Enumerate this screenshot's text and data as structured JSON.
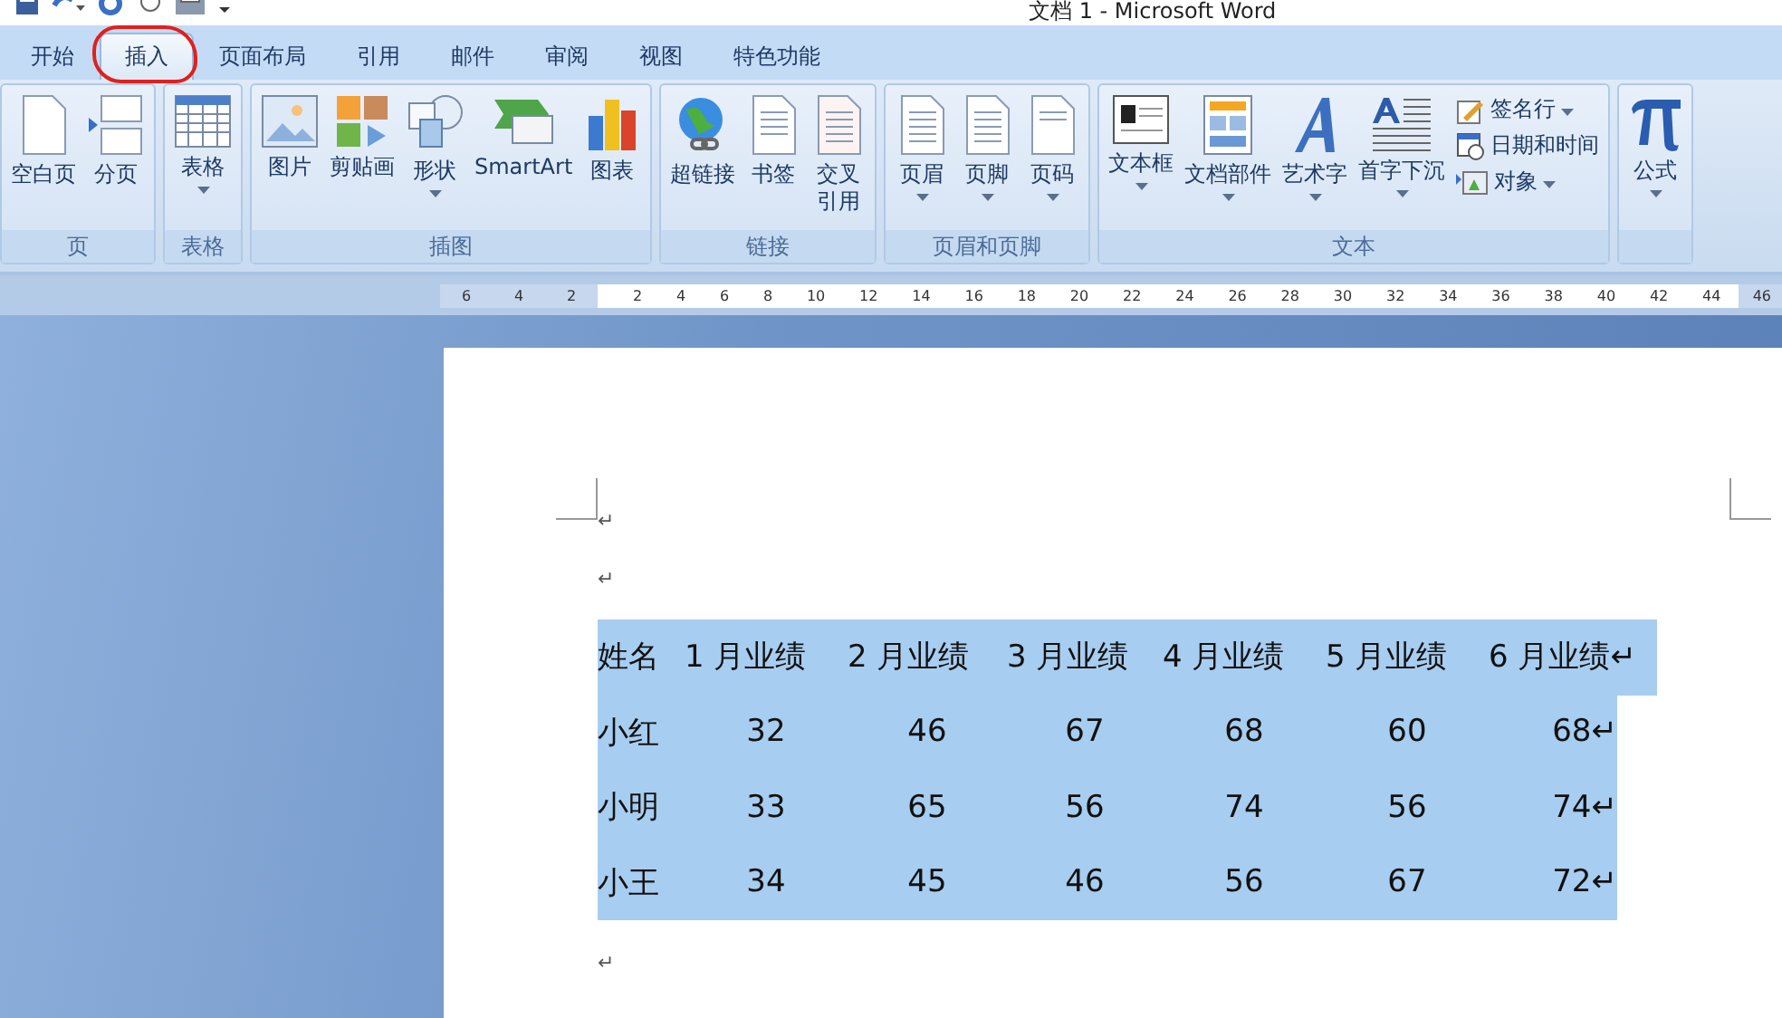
{
  "window": {
    "title": "文档 1 - Microsoft Word"
  },
  "tabs": [
    {
      "label": "开始",
      "selected": false
    },
    {
      "label": "插入",
      "selected": true
    },
    {
      "label": "页面布局",
      "selected": false
    },
    {
      "label": "引用",
      "selected": false
    },
    {
      "label": "邮件",
      "selected": false
    },
    {
      "label": "审阅",
      "selected": false
    },
    {
      "label": "视图",
      "selected": false
    },
    {
      "label": "特色功能",
      "selected": false
    }
  ],
  "ribbon_groups": [
    {
      "label": "页",
      "buttons": [
        {
          "label": "空白页",
          "dropdown": false
        },
        {
          "label": "分页",
          "dropdown": false
        }
      ]
    },
    {
      "label": "表格",
      "buttons": [
        {
          "label": "表格",
          "dropdown": true
        }
      ]
    },
    {
      "label": "插图",
      "buttons": [
        {
          "label": "图片",
          "dropdown": false
        },
        {
          "label": "剪贴画",
          "dropdown": false
        },
        {
          "label": "形状",
          "dropdown": true
        },
        {
          "label": "SmartArt",
          "dropdown": false
        },
        {
          "label": "图表",
          "dropdown": false
        }
      ]
    },
    {
      "label": "链接",
      "buttons": [
        {
          "label": "超链接",
          "dropdown": false
        },
        {
          "label": "书签",
          "dropdown": false
        },
        {
          "label": "交叉引用",
          "dropdown": false
        }
      ]
    },
    {
      "label": "页眉和页脚",
      "buttons": [
        {
          "label": "页眉",
          "dropdown": true
        },
        {
          "label": "页脚",
          "dropdown": true
        },
        {
          "label": "页码",
          "dropdown": true
        }
      ]
    },
    {
      "label": "文本",
      "buttons": [
        {
          "label": "文本框",
          "dropdown": true
        },
        {
          "label": "文档部件",
          "dropdown": true
        },
        {
          "label": "艺术字",
          "dropdown": true
        },
        {
          "label": "首字下沉",
          "dropdown": true
        }
      ],
      "small_buttons": [
        {
          "label": "签名行",
          "dropdown": true
        },
        {
          "label": "日期和时间",
          "dropdown": false
        },
        {
          "label": "对象",
          "dropdown": true
        }
      ]
    },
    {
      "buttons": [
        {
          "label": "公式",
          "dropdown": true
        }
      ]
    }
  ],
  "ruler": {
    "left_numbers": [
      "6",
      "4",
      "2"
    ],
    "numbers": [
      "2",
      "4",
      "6",
      "8",
      "10",
      "12",
      "14",
      "16",
      "18",
      "20",
      "22",
      "24",
      "26",
      "28",
      "30",
      "32",
      "34",
      "36",
      "38",
      "40",
      "42",
      "44"
    ],
    "right_numbers": [
      "46"
    ]
  },
  "document": {
    "paragraphs_before": [
      "↵",
      "↵"
    ],
    "table": {
      "rows": [
        {
          "kind": "header",
          "cells": [
            "姓名",
            "1 月业绩",
            "2 月业绩",
            "3 月业绩",
            "4 月业绩",
            "5 月业绩",
            "6 月业绩↵"
          ]
        },
        {
          "kind": "data",
          "cells": [
            "小红",
            "32",
            "46",
            "67",
            "68",
            "60",
            "68↵"
          ]
        },
        {
          "kind": "data",
          "cells": [
            "小明",
            "33",
            "65",
            "56",
            "74",
            "56",
            "74↵"
          ]
        },
        {
          "kind": "data",
          "cells": [
            "小王",
            "34",
            "45",
            "46",
            "56",
            "67",
            "72↵"
          ]
        }
      ],
      "selected": true
    },
    "paragraphs_after": [
      "↵"
    ]
  }
}
